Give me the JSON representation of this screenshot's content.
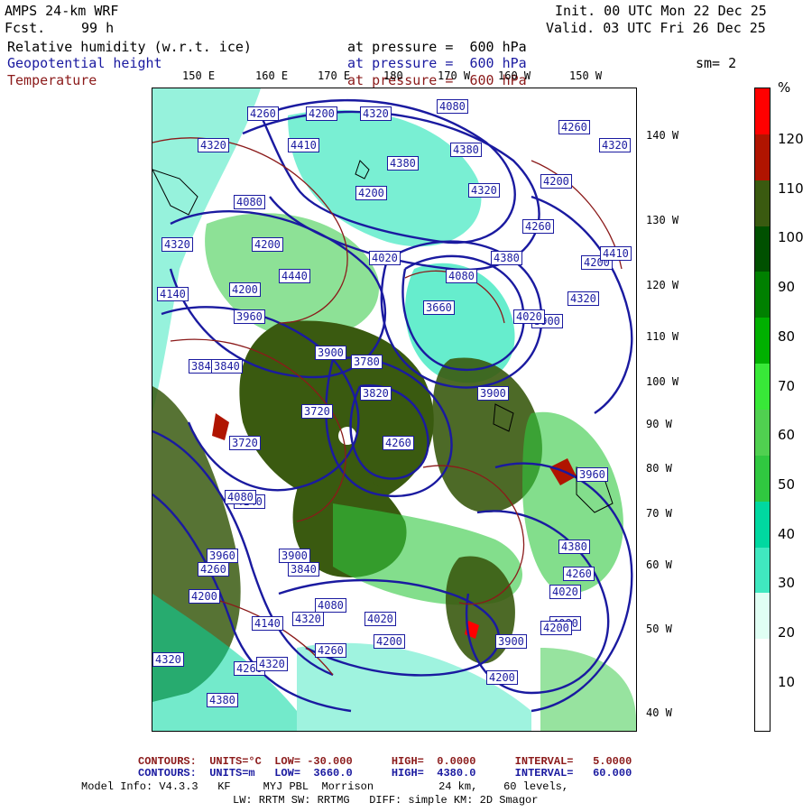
{
  "header": {
    "model": "AMPS 24-km WRF",
    "fcst_label": "Fcst.",
    "fcst_value": "99 h",
    "init": "Init. 00 UTC Mon 22 Dec 25",
    "valid": "Valid. 03 UTC Fri 26 Dec 25",
    "fields": [
      {
        "name": "Relative humidity (w.r.t. ice)",
        "level": "at pressure =  600 hPa",
        "color": "#000000"
      },
      {
        "name": "Geopotential height",
        "level": "at pressure =  600 hPa",
        "color": "#1a1aa0"
      },
      {
        "name": "Temperature",
        "level": "at pressure =  600 hPa",
        "color": "#8b1a1a"
      }
    ],
    "smoothing": "sm= 2"
  },
  "map": {
    "lon_labels": [
      "150 E",
      "160 E",
      "170 E",
      "180",
      "170 W",
      "160 W",
      "150 W"
    ],
    "lat_labels": [
      "140 W",
      "130 W",
      "120 W",
      "110 W",
      "100 W",
      "90 W",
      "80 W",
      "70 W",
      "60 W",
      "50 W",
      "40 W"
    ],
    "height_labels": [
      "4260",
      "4200",
      "4320",
      "4080",
      "4320",
      "4410",
      "4380",
      "4260",
      "4320",
      "4380",
      "4320",
      "4200",
      "4080",
      "4200",
      "4260",
      "4320",
      "4200",
      "4380",
      "4200",
      "4440",
      "4320",
      "4140",
      "4200",
      "4020",
      "3900",
      "3960",
      "4080",
      "3840",
      "3840",
      "3720",
      "3660",
      "3780",
      "3900",
      "3900",
      "3720",
      "3820",
      "4260",
      "3960",
      "3840",
      "4140",
      "3960",
      "3900",
      "4020",
      "4080",
      "4020",
      "4260",
      "4200",
      "3900",
      "4080",
      "4140",
      "4200",
      "4260",
      "4320",
      "4260",
      "4200",
      "4320",
      "4380",
      "4080",
      "4020",
      "4380",
      "4200",
      "4320",
      "4260",
      "4410"
    ],
    "land_fill": "#ffffff",
    "colors": {
      "height": "#1a1aa0",
      "temperature": "#8b1a1a"
    }
  },
  "colorbar": {
    "unit": "%",
    "labels": [
      "120",
      "110",
      "100",
      "90",
      "80",
      "70",
      "60",
      "50",
      "40",
      "30",
      "20",
      "10"
    ],
    "colors": [
      "#ffffff",
      "#ffffff",
      "#e0fff4",
      "#40e8c0",
      "#00d8a0",
      "#30c840",
      "#50d050",
      "#38e838",
      "#00b000",
      "#008000",
      "#005000",
      "#3a5a10",
      "#b01400",
      "#ff0000"
    ]
  },
  "footer": {
    "line1": "CONTOURS:  UNITS=°C  LOW= -30.000      HIGH=  0.0000      INTERVAL=   5.0000",
    "line2": "CONTOURS:  UNITS=m   LOW=  3660.0      HIGH=  4380.0      INTERVAL=   60.000",
    "line3": "Model Info: V4.3.3   KF     MYJ PBL  Morrison          24 km,    60 levels,",
    "line4": "LW: RRTM SW: RRTMG   DIFF: simple KM: 2D Smagor"
  }
}
